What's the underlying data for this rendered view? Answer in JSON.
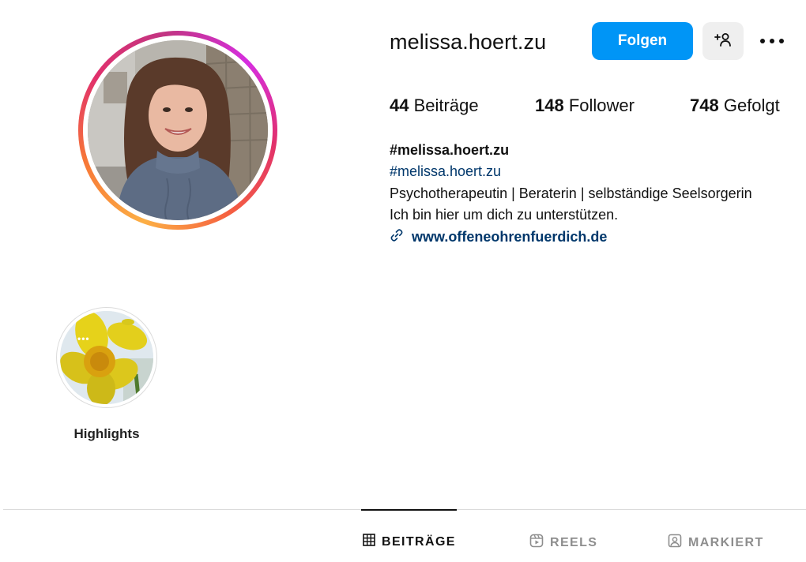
{
  "profile": {
    "username": "melissa.hoert.zu",
    "follow_label": "Folgen",
    "stats": {
      "posts_count": "44",
      "posts_label": "Beiträge",
      "followers_count": "148",
      "followers_label": "Follower",
      "following_count": "748",
      "following_label": "Gefolgt"
    },
    "bio": {
      "name": "#melissa.hoert.zu",
      "hashtag": "#melissa.hoert.zu",
      "line1": "Psychotherapeutin | Beraterin | selbständige Seelsorgerin",
      "line2": "Ich bin hier um dich zu unterstützen.",
      "link": "www.offeneohrenfuerdich.de"
    }
  },
  "highlights": [
    {
      "label": "Highlights"
    }
  ],
  "tabs": [
    {
      "label": "BEITRÄGE",
      "icon": "grid-icon",
      "active": true
    },
    {
      "label": "REELS",
      "icon": "reels-icon",
      "active": false
    },
    {
      "label": "MARKIERT",
      "icon": "tagged-icon",
      "active": false
    }
  ],
  "colors": {
    "primary_button": "#0095f6",
    "secondary_button": "#efefef",
    "link": "#00376b",
    "divider": "#dbdbdb",
    "inactive_tab": "#8e8e8e"
  }
}
